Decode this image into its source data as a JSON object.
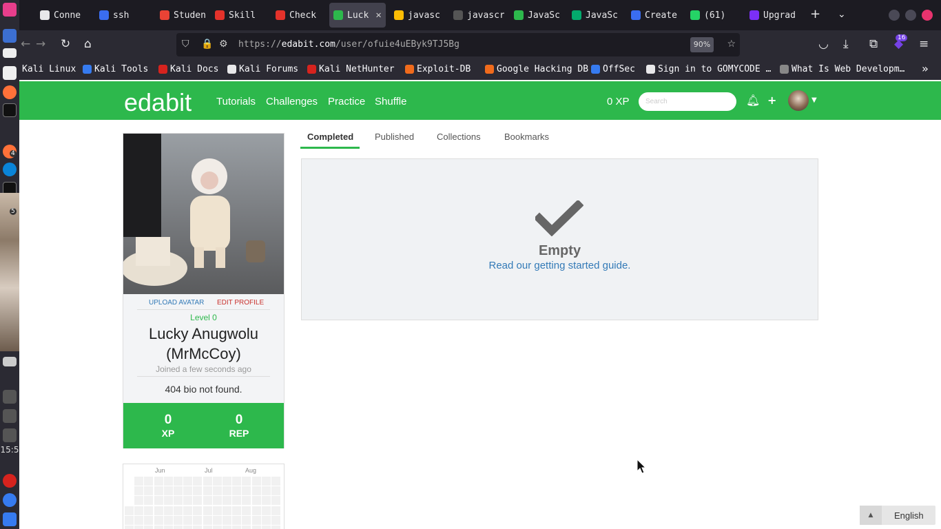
{
  "dock": {
    "clock": "15:5",
    "badge_a": "4",
    "badge_b": "5"
  },
  "browser": {
    "tabs": [
      {
        "label": "Conne",
        "color": "#e8e8ea"
      },
      {
        "label": "ssh",
        "color": "#3a6df0"
      },
      {
        "label": "Studen",
        "color": "#ea4335"
      },
      {
        "label": "Skill",
        "color": "#e4322b"
      },
      {
        "label": "Check",
        "color": "#e4322b"
      },
      {
        "label": "Luck",
        "color": "#2db84c",
        "active": true
      },
      {
        "label": "javasc",
        "color": "#fbbc04"
      },
      {
        "label": "javascrip",
        "color": "#555555"
      },
      {
        "label": "JavaSc",
        "color": "#2db84c"
      },
      {
        "label": "JavaSc",
        "color": "#04aa6d"
      },
      {
        "label": "Create",
        "color": "#3a6df0"
      },
      {
        "label": "(61)",
        "color": "#25d366"
      },
      {
        "label": "Upgrad",
        "color": "#7b2ff7"
      }
    ],
    "url_prefix": "https://",
    "url_host": "edabit.com",
    "url_path": "/user/ofuie4uEByk9TJ5Bg",
    "zoom": "90%",
    "extensions_badge": "16",
    "bookmarks": [
      {
        "label": "Kali Linux",
        "color": "#2b2a33"
      },
      {
        "label": "Kali Tools",
        "color": "#367bf0"
      },
      {
        "label": "Kali Docs",
        "color": "#d6231e"
      },
      {
        "label": "Kali Forums",
        "color": "#e8e8ea"
      },
      {
        "label": "Kali NetHunter",
        "color": "#d6231e"
      },
      {
        "label": "Exploit-DB",
        "color": "#f06b1c"
      },
      {
        "label": "Google Hacking DB",
        "color": "#f06b1c"
      },
      {
        "label": "OffSec",
        "color": "#367bf0"
      },
      {
        "label": "Sign in to GOMYCODE …",
        "color": "#e8e8ea"
      },
      {
        "label": "What Is Web Developm…",
        "color": "#888888"
      }
    ]
  },
  "site": {
    "logo": "edabit",
    "nav": [
      "Tutorials",
      "Challenges",
      "Practice",
      "Shuffle"
    ],
    "xp": "0 XP",
    "search_placeholder": "Search",
    "brand_color": "#2db84c"
  },
  "profile": {
    "upload_avatar": "UPLOAD AVATAR",
    "edit_profile": "EDIT PROFILE",
    "level": "Level 0",
    "name_line1": "Lucky Anugwolu",
    "name_line2": "(MrMcCoy)",
    "joined": "Joined a few seconds ago",
    "bio": "404 bio not found.",
    "xp_value": "0",
    "xp_label": "XP",
    "rep_value": "0",
    "rep_label": "REP",
    "calendar_months": [
      "Jun",
      "Jul",
      "Aug"
    ]
  },
  "content": {
    "tabs": [
      "Completed",
      "Published",
      "Collections",
      "Bookmarks"
    ],
    "active_tab": "Completed",
    "empty_title": "Empty",
    "guide_link": "Read our getting started guide."
  },
  "footer": {
    "language": "English"
  }
}
